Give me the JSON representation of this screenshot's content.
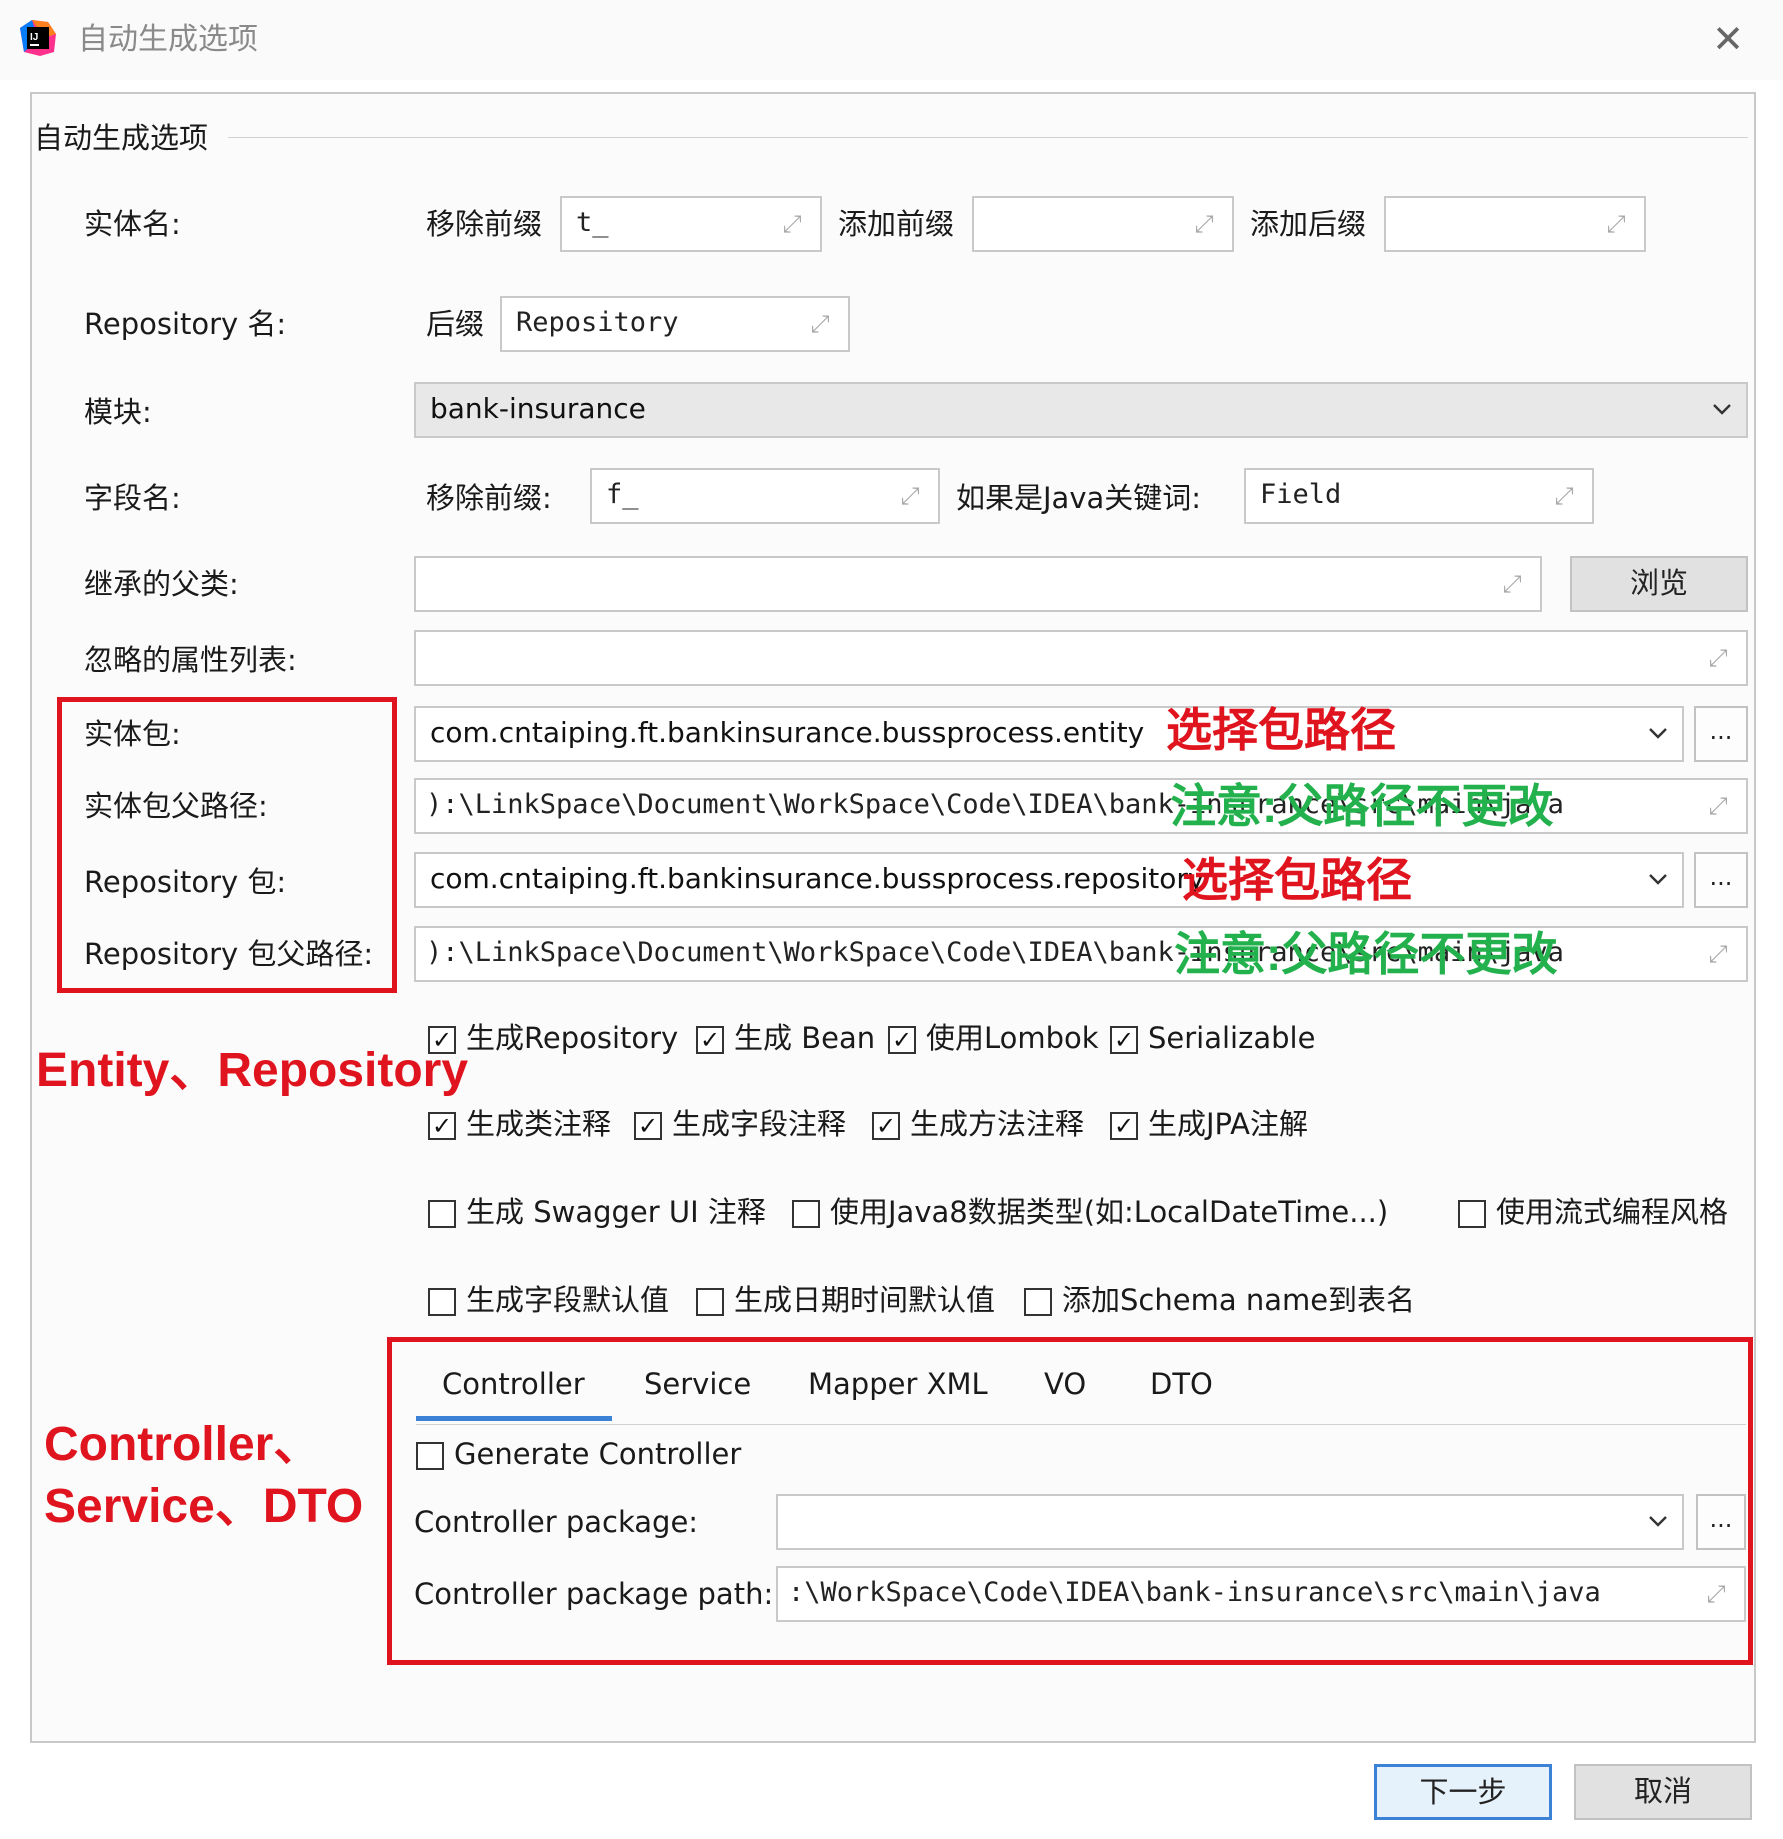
{
  "window": {
    "title": "自动生成选项",
    "close_icon": "close-icon",
    "app_icon": "intellij-idea-icon"
  },
  "group": {
    "title": "自动生成选项"
  },
  "entity_name": {
    "label": "实体名:",
    "remove_prefix_label": "移除前缀",
    "remove_prefix_value": "t_",
    "add_prefix_label": "添加前缀",
    "add_prefix_value": "",
    "add_suffix_label": "添加后缀",
    "add_suffix_value": ""
  },
  "repository_name": {
    "label": "Repository 名:",
    "suffix_label": "后缀",
    "suffix_value": "Repository"
  },
  "module": {
    "label": "模块:",
    "value": "bank-insurance"
  },
  "field_name": {
    "label": "字段名:",
    "remove_prefix_label": "移除前缀:",
    "remove_prefix_value": "f_",
    "java_keyword_label": "如果是Java关键词:",
    "java_keyword_value": "Field"
  },
  "parent_class": {
    "label": "继承的父类:",
    "value": "",
    "browse_label": "浏览"
  },
  "ignore_props": {
    "label": "忽略的属性列表:",
    "value": ""
  },
  "entity_package": {
    "label": "实体包:",
    "value": "com.cntaiping.ft.bankinsurance.bussprocess.entity",
    "more_label": "..."
  },
  "entity_parent_path": {
    "label": "实体包父路径:",
    "value": "):\\LinkSpace\\Document\\WorkSpace\\Code\\IDEA\\bank-insurance\\src\\main\\java"
  },
  "repository_package": {
    "label": "Repository 包:",
    "value": "com.cntaiping.ft.bankinsurance.bussprocess.repository",
    "more_label": "..."
  },
  "repository_parent_path": {
    "label": "Repository 包父路径:",
    "value": "):\\LinkSpace\\Document\\WorkSpace\\Code\\IDEA\\bank-insurance\\src\\main\\java"
  },
  "options_row1": [
    {
      "label": "生成Repository",
      "checked": true
    },
    {
      "label": "生成 Bean",
      "checked": true
    },
    {
      "label": "使用Lombok",
      "checked": true
    },
    {
      "label": "Serializable",
      "checked": true
    }
  ],
  "options_row2": [
    {
      "label": "生成类注释",
      "checked": true
    },
    {
      "label": "生成字段注释",
      "checked": true
    },
    {
      "label": "生成方法注释",
      "checked": true
    },
    {
      "label": "生成JPA注解",
      "checked": true
    }
  ],
  "options_row3": [
    {
      "label": "生成 Swagger UI 注释",
      "checked": false
    },
    {
      "label": "使用Java8数据类型(如:LocalDateTime...)",
      "checked": false
    },
    {
      "label": "使用流式编程风格",
      "checked": false
    }
  ],
  "options_row4": [
    {
      "label": "生成字段默认值",
      "checked": false
    },
    {
      "label": "生成日期时间默认值",
      "checked": false
    },
    {
      "label": "添加Schema name到表名",
      "checked": false
    }
  ],
  "tabs": [
    {
      "label": "Controller",
      "active": true
    },
    {
      "label": "Service",
      "active": false
    },
    {
      "label": "Mapper XML",
      "active": false
    },
    {
      "label": "VO",
      "active": false
    },
    {
      "label": "DTO",
      "active": false
    }
  ],
  "controller": {
    "generate_label": "Generate Controller",
    "generate_checked": false,
    "package_label": "Controller package:",
    "package_value": "",
    "more_label": "...",
    "path_label": "Controller package path:",
    "path_value": ":\\WorkSpace\\Code\\IDEA\\bank-insurance\\src\\main\\java"
  },
  "annotations": {
    "select_package_1": "选择包路径",
    "note_parent_1": "注意:父路径不更改",
    "select_package_2": "选择包路径",
    "note_parent_2": "注意:父路径不更改",
    "entity_repository": "Entity、Repository",
    "controller_service_dto_1": "Controller、",
    "controller_service_dto_2": "Service、DTO",
    "red_color": "#e0141e",
    "green_color": "#22b14c"
  },
  "footer": {
    "next_label": "下一步",
    "cancel_label": "取消"
  },
  "colors": {
    "accent": "#3b82d6",
    "annotation_red": "#e0141e",
    "annotation_green": "#22b14c"
  }
}
